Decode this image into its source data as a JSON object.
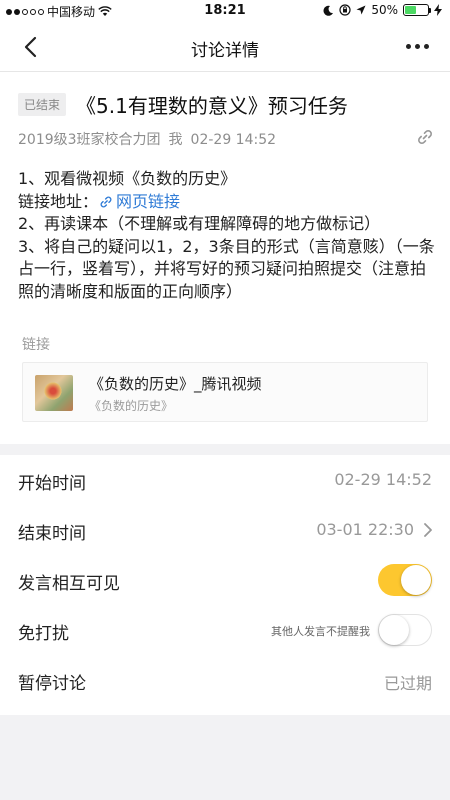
{
  "status_bar": {
    "carrier": "中国移动",
    "time": "18:21",
    "battery": "50%",
    "battery_level": 0.5,
    "icons": [
      "signal-dots-icon",
      "wifi-icon",
      "moon-icon",
      "orientation-lock-icon",
      "location-arrow-icon",
      "battery-icon",
      "charging-bolt-icon"
    ]
  },
  "nav": {
    "title": "讨论详情",
    "back_icon": "chevron-left-icon",
    "more_icon": "more-dots-icon"
  },
  "task": {
    "badge": "已结束",
    "title": "《5.1有理数的意义》预习任务",
    "group": "2019级3班家校合力团",
    "author": "我",
    "datetime": "02-29 14:52",
    "link_icon": "link-icon"
  },
  "body": {
    "line1": "1、观看微视频《负数的历史》",
    "line2_prefix": "链接地址：",
    "line2_link": "网页链接",
    "line3": "2、再读课本（不理解或有理解障碍的地方做标记）",
    "line4": "3、将自己的疑问以1，2，3条目的形式（言简意赅）（一条占一行，竖着写），并将写好的预习疑问拍照提交（注意拍照的清晰度和版面的正向顺序）"
  },
  "links": {
    "label": "链接",
    "card_title": "《负数的历史》_腾讯视频",
    "card_subtitle": "《负数的历史》"
  },
  "settings": {
    "start_label": "开始时间",
    "start_value": "02-29 14:52",
    "end_label": "结束时间",
    "end_value": "03-01 22:30",
    "visible_label": "发言相互可见",
    "visible_on": true,
    "dnd_label": "免打扰",
    "dnd_hint": "其他人发言不提醒我",
    "dnd_on": false,
    "pause_label": "暂停讨论",
    "pause_value": "已过期"
  },
  "colors": {
    "accent": "#fdc72f",
    "link": "#2f7bd6",
    "battery": "#4cd964"
  }
}
